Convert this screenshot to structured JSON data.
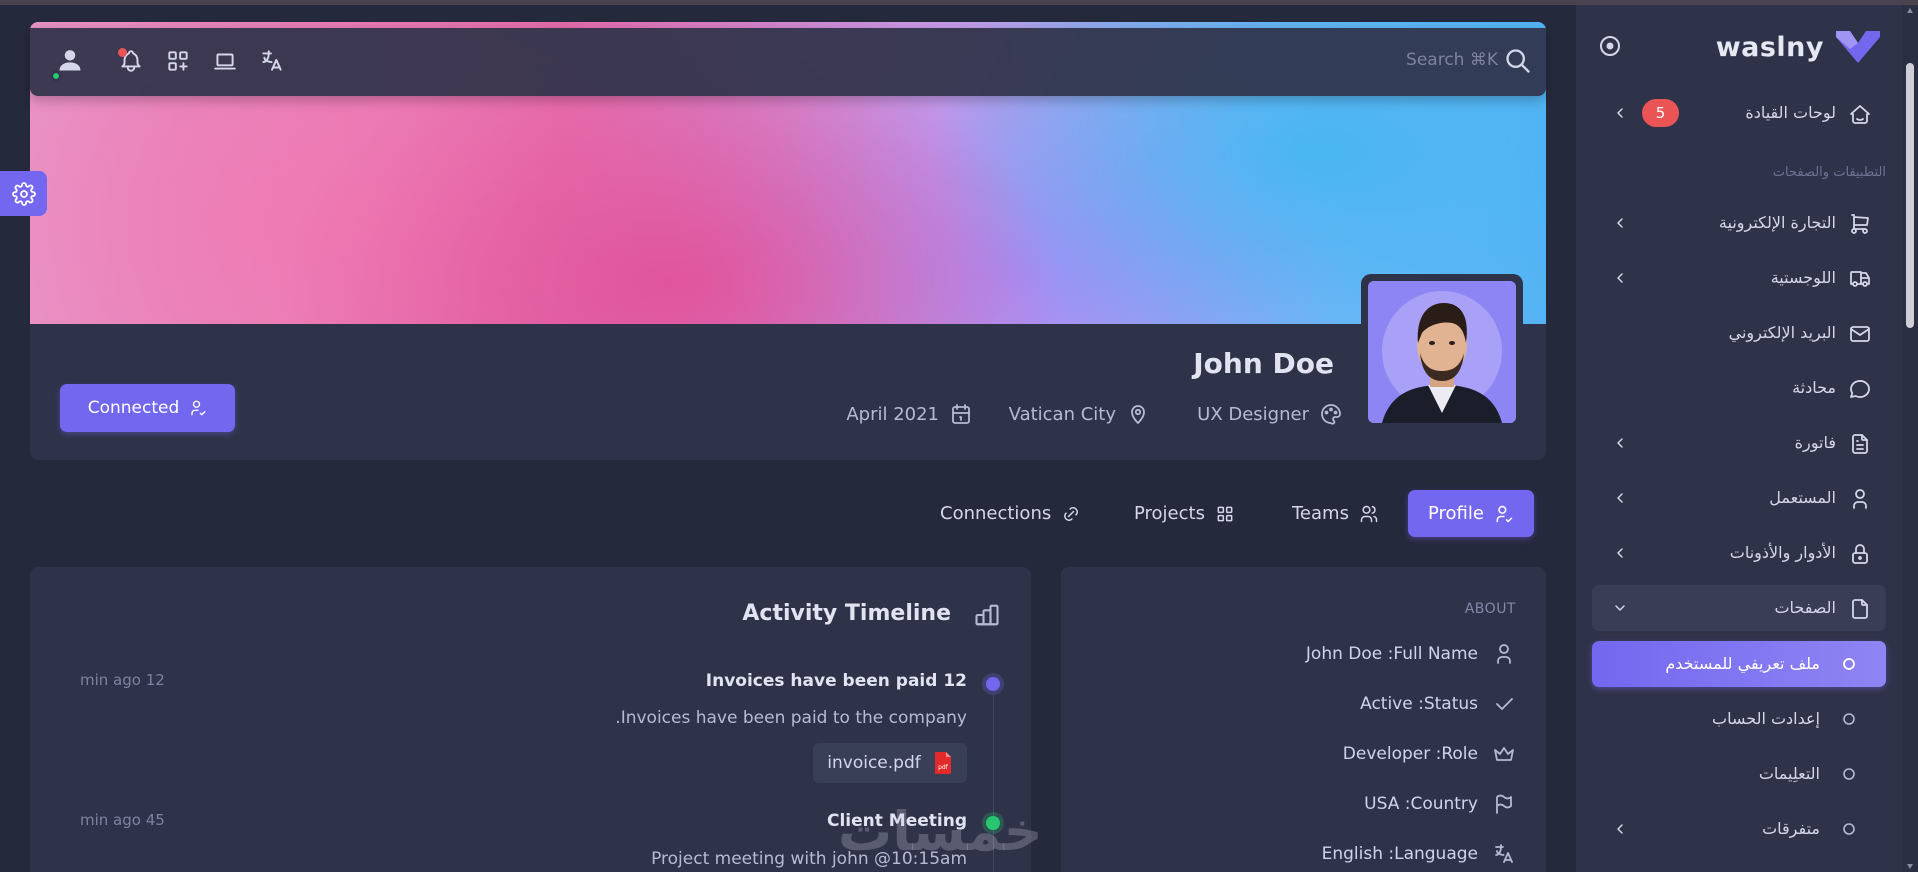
{
  "brand": {
    "name": "waslny",
    "accent": "#7367f0"
  },
  "navbar": {
    "search_placeholder": "Search ⌘K"
  },
  "profile": {
    "name": "John Doe",
    "joined": "April 2021",
    "location": "Vatican City",
    "title": "UX Designer",
    "connected_label": "Connected"
  },
  "tabs": [
    {
      "label": "Profile",
      "active": true,
      "icon": "user-check-icon"
    },
    {
      "label": "Teams",
      "active": false,
      "icon": "users-icon"
    },
    {
      "label": "Projects",
      "active": false,
      "icon": "grid-icon"
    },
    {
      "label": "Connections",
      "active": false,
      "icon": "link-icon"
    }
  ],
  "about": {
    "title": "ABOUT",
    "rows": [
      {
        "text": "John Doe  :Full Name",
        "icon": "user-icon"
      },
      {
        "text": "Active  :Status",
        "icon": "check-icon"
      },
      {
        "text": "Developer  :Role",
        "icon": "crown-icon"
      },
      {
        "text": "USA  :Country",
        "icon": "flag-icon"
      },
      {
        "text": "English  :Language",
        "icon": "translate-icon"
      }
    ]
  },
  "activity": {
    "title": "Activity Timeline",
    "items": [
      {
        "title": "Invoices have been paid 12",
        "desc": ".Invoices have been paid to the company",
        "time": "min ago 12",
        "attachment": "invoice.pdf",
        "dot": "#7367f0"
      },
      {
        "title": "Client Meeting",
        "desc": "Project meeting with john @10:15am",
        "time": "min ago 45",
        "dot": "#28c76f"
      }
    ]
  },
  "sidebar": {
    "section_label": "التطبيقات والصفحات",
    "items": [
      {
        "label": "لوحات القيادة",
        "icon": "home-icon",
        "badge": "5",
        "chevron": true
      },
      {
        "label": "التجارة الإلكترونية",
        "icon": "cart-icon",
        "chevron": true
      },
      {
        "label": "اللوجستية",
        "icon": "truck-icon",
        "chevron": true
      },
      {
        "label": "البريد الإلكتروني",
        "icon": "mail-icon",
        "chevron": false
      },
      {
        "label": "محادثة",
        "icon": "chat-icon",
        "chevron": false
      },
      {
        "label": "فاتورة",
        "icon": "file-text-icon",
        "chevron": true
      },
      {
        "label": "المستعمل",
        "icon": "user-icon",
        "chevron": true
      },
      {
        "label": "الأدوار والأذونات",
        "icon": "lock-icon",
        "chevron": true
      },
      {
        "label": "الصفحات",
        "icon": "file-icon",
        "chevron": true,
        "open": true
      }
    ],
    "sub_items": [
      {
        "label": "ملف تعريفي للمستخدم",
        "active": true
      },
      {
        "label": "إعدادت الحساب",
        "active": false
      },
      {
        "label": "التعلِيمات",
        "active": false
      },
      {
        "label": "متفرقات",
        "active": false,
        "chevron": true
      }
    ]
  },
  "watermark": "خمسات"
}
